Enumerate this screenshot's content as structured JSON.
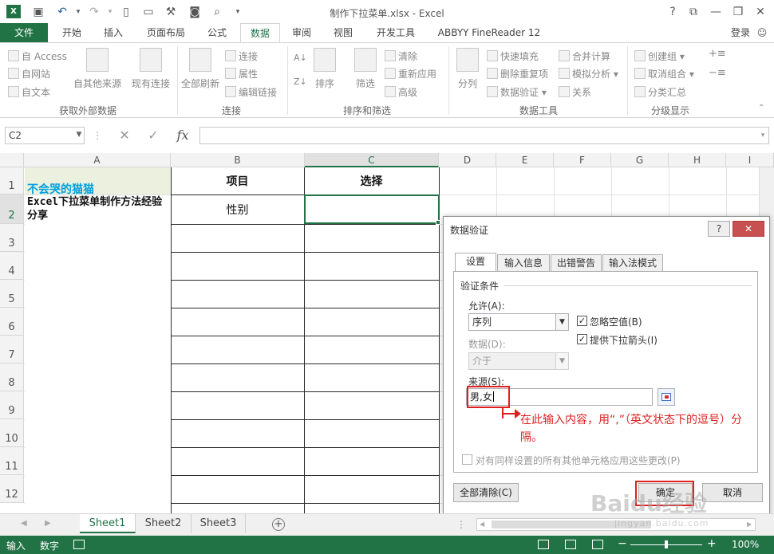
{
  "window": {
    "title": "制作下拉菜单.xlsx - Excel",
    "help": "?",
    "app_icon": "X"
  },
  "ribbon_tabs": [
    "文件",
    "开始",
    "插入",
    "页面布局",
    "公式",
    "数据",
    "审阅",
    "视图",
    "开发工具",
    "ABBYY FineReader 12"
  ],
  "active_tab": "数据",
  "login": "登录",
  "ribbon": {
    "external": {
      "access": "自 Access",
      "web": "自网站",
      "text": "自文本",
      "other": "自其他来源",
      "existing": "现有连接",
      "label": "获取外部数据"
    },
    "connections": {
      "refresh": "全部刷新",
      "conn": "连接",
      "props": "属性",
      "edit": "编辑链接",
      "label": "连接"
    },
    "sort": {
      "sort": "排序",
      "filter": "筛选",
      "clear": "清除",
      "reapply": "重新应用",
      "advanced": "高级",
      "label": "排序和筛选"
    },
    "tools": {
      "split": "分列",
      "flash": "快速填充",
      "dedupe": "删除重复项",
      "validate": "数据验证",
      "consolidate": "合并计算",
      "whatif": "模拟分析",
      "relations": "关系",
      "label": "数据工具"
    },
    "outline": {
      "group": "创建组",
      "ungroup": "取消组合",
      "subtotal": "分类汇总",
      "label": "分级显示"
    }
  },
  "formula_bar": {
    "name_box": "C2",
    "fx": "fx"
  },
  "columns": [
    "A",
    "B",
    "C",
    "D",
    "E",
    "F",
    "G",
    "H",
    "I"
  ],
  "rows": [
    "1",
    "2",
    "3",
    "4",
    "5",
    "6",
    "7",
    "8",
    "9",
    "10",
    "11",
    "12"
  ],
  "cells": {
    "A1": "不会哭的猫猫",
    "A2": "Excel下拉菜单制作方法经验分享",
    "B1": "项目",
    "C1": "选择",
    "B2": "性别"
  },
  "dialog": {
    "title": "数据验证",
    "help": "?",
    "close": "✕",
    "tabs": [
      "设置",
      "输入信息",
      "出错警告",
      "输入法模式"
    ],
    "section": "验证条件",
    "allow_label": "允许(A):",
    "allow_value": "序列",
    "data_label": "数据(D):",
    "data_value": "介于",
    "ignore_blank": "忽略空值(B)",
    "dropdown": "提供下拉箭头(I)",
    "source_label": "来源(S):",
    "source_value": "男,女",
    "apply_all": "对有同样设置的所有其他单元格应用这些更改(P)",
    "clear_all": "全部清除(C)",
    "ok": "确定",
    "cancel": "取消"
  },
  "annotation": "在此输入内容，用“,”（英文状态下的逗号）分隔。",
  "sheets": [
    "Sheet1",
    "Sheet2",
    "Sheet3"
  ],
  "active_sheet": "Sheet1",
  "status": {
    "mode": "输入",
    "numlock": "数字",
    "zoom": "100%"
  },
  "watermark": {
    "main": "Baidu经验",
    "sub": "jingyan.baidu.com"
  },
  "colors": {
    "excel_green": "#217346",
    "annotation_red": "#e02020",
    "a1_text": "#00a0e0"
  }
}
